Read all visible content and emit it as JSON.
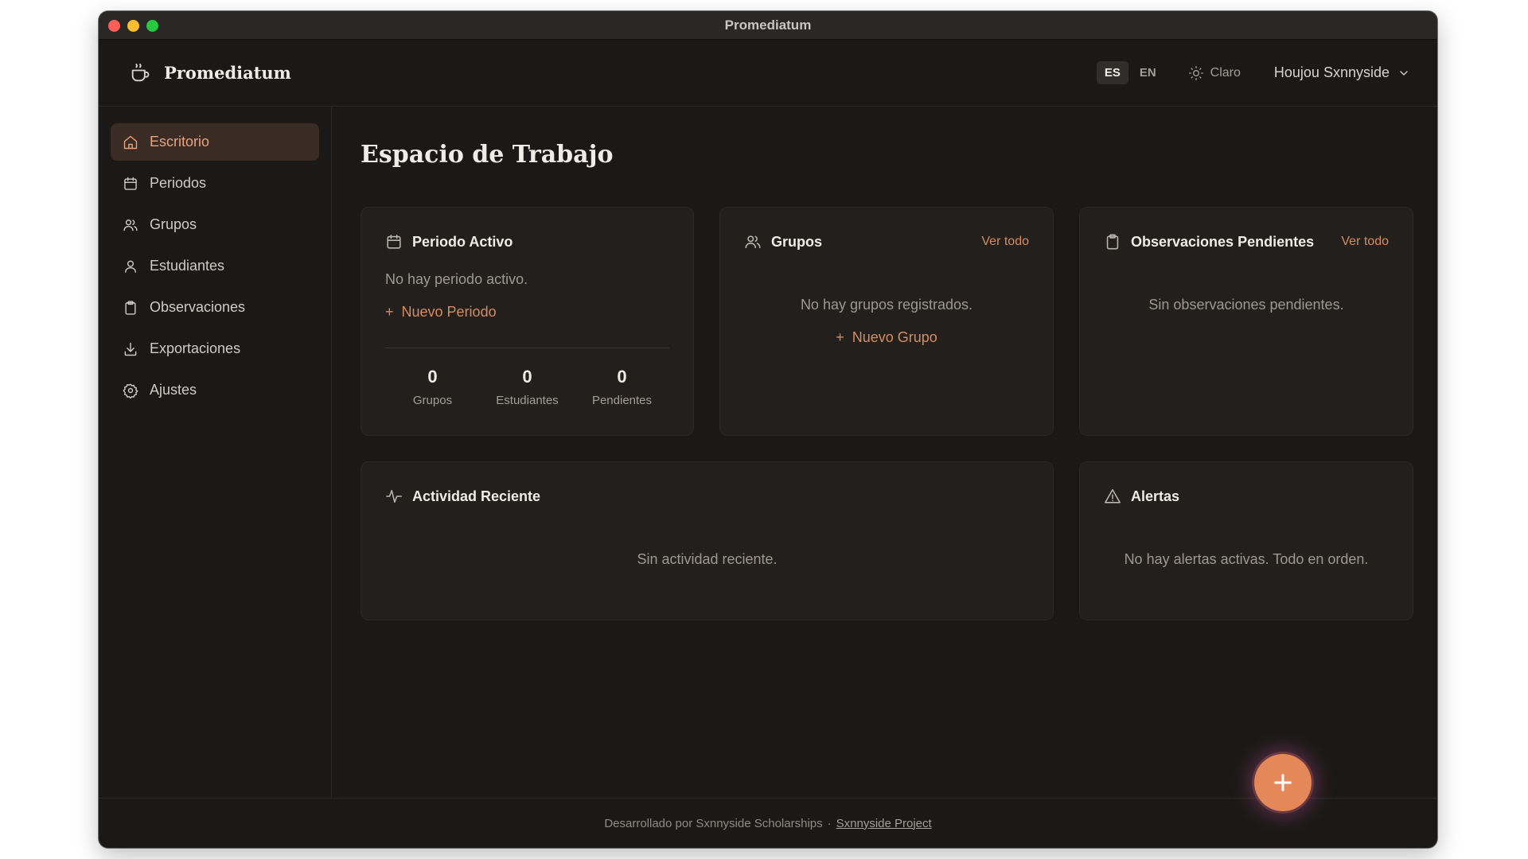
{
  "window": {
    "title": "Promediatum"
  },
  "header": {
    "brand": "Promediatum",
    "lang_options": [
      "ES",
      "EN"
    ],
    "lang_selected": "ES",
    "theme_label": "Claro",
    "user_name": "Houjou Sxnnyside"
  },
  "sidebar": {
    "items": [
      {
        "label": "Escritorio",
        "icon": "home-icon",
        "active": true
      },
      {
        "label": "Periodos",
        "icon": "calendar-icon"
      },
      {
        "label": "Grupos",
        "icon": "users-icon"
      },
      {
        "label": "Estudiantes",
        "icon": "user-icon"
      },
      {
        "label": "Observaciones",
        "icon": "clipboard-icon"
      },
      {
        "label": "Exportaciones",
        "icon": "download-icon"
      },
      {
        "label": "Ajustes",
        "icon": "gear-icon"
      }
    ]
  },
  "main": {
    "title": "Espacio de Trabajo",
    "active_period": {
      "title": "Periodo Activo",
      "empty": "No hay periodo activo.",
      "action": "Nuevo Periodo",
      "stats": [
        {
          "value": "0",
          "label": "Grupos"
        },
        {
          "value": "0",
          "label": "Estudiantes"
        },
        {
          "value": "0",
          "label": "Pendientes"
        }
      ]
    },
    "groups": {
      "title": "Grupos",
      "link": "Ver todo",
      "empty": "No hay grupos registrados.",
      "action": "Nuevo Grupo"
    },
    "pending": {
      "title": "Observaciones Pendientes",
      "link": "Ver todo",
      "empty": "Sin observaciones pendientes."
    },
    "activity": {
      "title": "Actividad Reciente",
      "empty": "Sin actividad reciente."
    },
    "alerts": {
      "title": "Alertas",
      "empty": "No hay alertas activas. Todo en orden."
    }
  },
  "footer": {
    "text": "Desarrollado por Sxnnyside Scholarships",
    "separator": "·",
    "link": "Sxnnyside Project"
  },
  "colors": {
    "accent": "#d88c5e",
    "background": "#1b1917",
    "card": "#221f1d",
    "active_nav": "#3a2c24"
  }
}
